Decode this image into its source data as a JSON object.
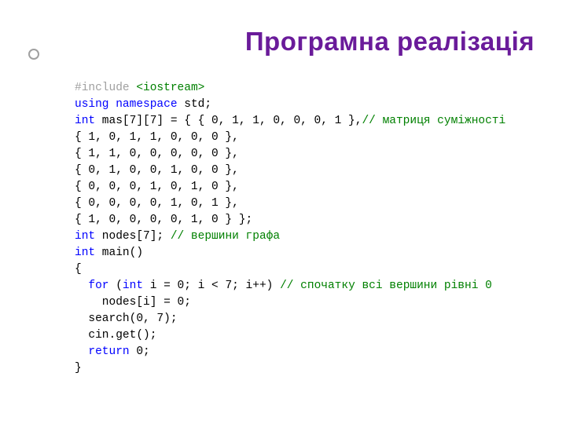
{
  "title": "Програмна реалізація",
  "code": {
    "l1_pp": "#include ",
    "l1_inc": "<iostream>",
    "l2_kw1": "using",
    "l2_sp1": " ",
    "l2_kw2": "namespace",
    "l2_pl": " std;",
    "l3_kw": "int",
    "l3_pl": " mas[7][7] = { { 0, 1, 1, 0, 0, 0, 1 },",
    "l3_cm": "// матриця суміжності",
    "l4": "{ 1, 0, 1, 1, 0, 0, 0 },",
    "l5": "{ 1, 1, 0, 0, 0, 0, 0 },",
    "l6": "{ 0, 1, 0, 0, 1, 0, 0 },",
    "l7": "{ 0, 0, 0, 1, 0, 1, 0 },",
    "l8": "{ 0, 0, 0, 0, 1, 0, 1 },",
    "l9": "{ 1, 0, 0, 0, 0, 1, 0 } };",
    "l10_kw": "int",
    "l10_pl": " nodes[7]; ",
    "l10_cm": "// вершини графа",
    "l11_kw": "int",
    "l11_pl": " main()",
    "l12": "{",
    "l13_pre": "  ",
    "l13_kw1": "for",
    "l13_mid1": " (",
    "l13_kw2": "int",
    "l13_mid2": " i = 0; i < 7; i++) ",
    "l13_cm": "// спочатку всі вершини рівні 0",
    "l14": "    nodes[i] = 0;",
    "l15": "  search(0, 7);",
    "l16": "  cin.get();",
    "l17_pre": "  ",
    "l17_kw": "return",
    "l17_pl": " 0;",
    "l18": "}"
  }
}
